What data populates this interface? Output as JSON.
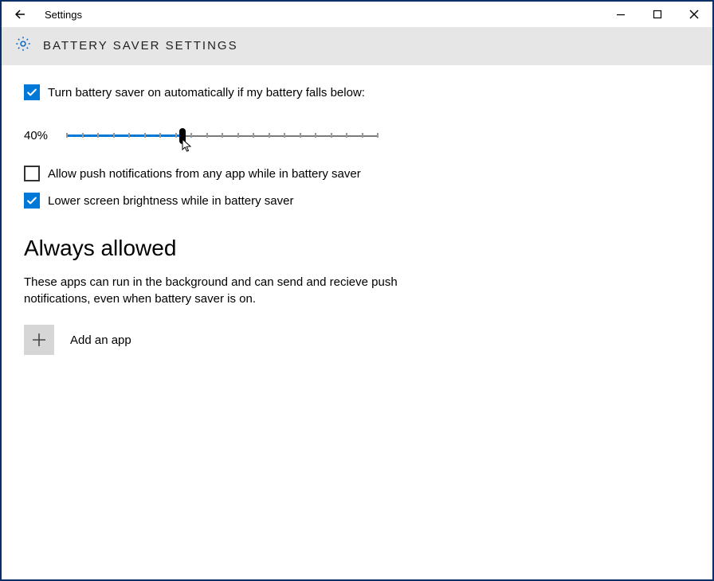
{
  "window": {
    "title": "Settings"
  },
  "header": {
    "title": "BATTERY SAVER SETTINGS"
  },
  "options": {
    "auto_on": {
      "label": "Turn battery saver on automatically if my battery falls below:",
      "checked": true
    },
    "threshold_pct": "40%",
    "slider_value": 40,
    "push_notifications": {
      "label": "Allow push notifications from any app while in battery saver",
      "checked": false
    },
    "lower_brightness": {
      "label": "Lower screen brightness while in battery saver",
      "checked": true
    }
  },
  "always_allowed": {
    "heading": "Always allowed",
    "body": "These apps can run in the background and can send and recieve push notifications, even when battery saver is on.",
    "add_label": "Add an app"
  }
}
